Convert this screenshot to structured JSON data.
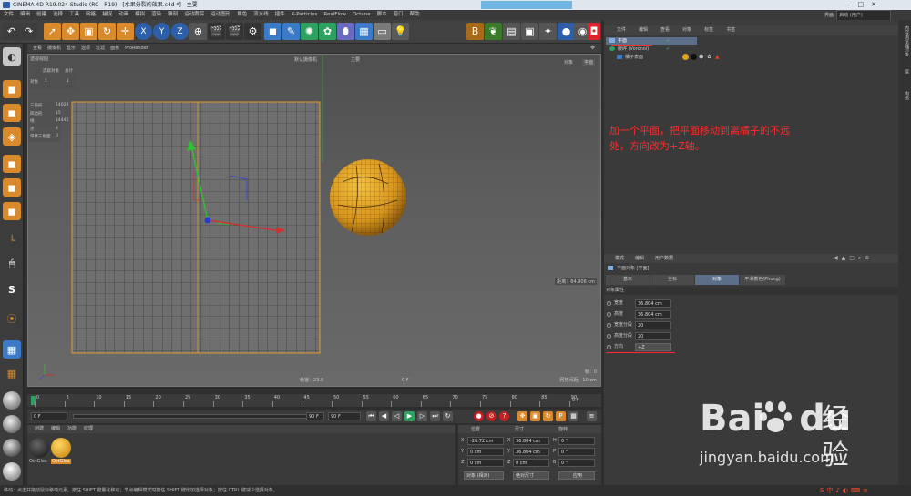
{
  "window": {
    "title": "CINEMA 4D R19.024 Studio (RC - R19) - [水果分裂的效果.c4d *] - 主要"
  },
  "menubar": [
    "文件",
    "编辑",
    "创建",
    "选择",
    "工具",
    "网格",
    "捕捉",
    "动画",
    "模拟",
    "渲染",
    "雕刻",
    "运动跟踪",
    "运动图形",
    "角色",
    "流水线",
    "插件",
    "X-Particles",
    "RealFlow",
    "Octane",
    "脚本",
    "窗口",
    "帮助"
  ],
  "interface": {
    "label": "界面:",
    "value": "启动 (用户)"
  },
  "toolbar": {
    "axis_x": "X",
    "axis_y": "Y",
    "axis_z": "Z"
  },
  "viewport": {
    "menu": [
      "查看",
      "摄像机",
      "显示",
      "选项",
      "过滤",
      "面板",
      "ProRender"
    ],
    "name": "透视视图",
    "camera_label": "默认摄像机",
    "camera_icon_label": "主要",
    "top_right_1": "对象",
    "top_right_2": "平面",
    "stats_header": [
      "选取对象",
      "总计"
    ],
    "stats_object_row": [
      "对象",
      "1",
      "1"
    ],
    "stats": [
      {
        "k": "三角形",
        "v": "14024"
      },
      {
        "k": "四边形",
        "v": "15"
      },
      {
        "k": "线",
        "v": "14445"
      },
      {
        "k": "点",
        "v": "4"
      },
      {
        "k": "带状三角面",
        "v": "0"
      }
    ],
    "distance": "距离：84.906 cm",
    "frame_rate": "帧速：23.8",
    "frame_center": "0 F",
    "grid_spacing": "网格间距：10 cm",
    "bottom_right_counter": "帧：0"
  },
  "timeline": {
    "ticks": [
      "0",
      "5",
      "10",
      "15",
      "20",
      "25",
      "30",
      "35",
      "40",
      "45",
      "50",
      "55",
      "60",
      "65",
      "70",
      "75",
      "80",
      "85",
      "90"
    ],
    "end": "0 F"
  },
  "transport": {
    "start": "0 F",
    "range_end": "90 F",
    "end": "90 F"
  },
  "materials": {
    "menu": [
      "创建",
      "编辑",
      "功能",
      "纹理"
    ],
    "items": [
      {
        "name": "OctGlos",
        "color": "#1d1d1d"
      },
      {
        "name": "OctGlos",
        "color": "#e0a020"
      }
    ]
  },
  "coords": {
    "headers": [
      "位置",
      "尺寸",
      "旋转"
    ],
    "rows": [
      {
        "axis": "X",
        "pos": "-26.72 cm",
        "size": "36.804 cm",
        "rot_label": "H",
        "rot": "0 °"
      },
      {
        "axis": "Y",
        "pos": "0 cm",
        "size": "36.804 cm",
        "rot_label": "P",
        "rot": "0 °"
      },
      {
        "axis": "Z",
        "pos": "0 cm",
        "size": "0 cm",
        "rot_label": "B",
        "rot": "0 °"
      }
    ],
    "mode": "对象 (相对)",
    "size_mode": "绝对尺寸",
    "apply": "应用"
  },
  "object_manager": {
    "menu": [
      "文件",
      "编辑",
      "查看",
      "对象",
      "标签",
      "书签"
    ],
    "objects": [
      {
        "name": "平面",
        "selected": true
      },
      {
        "name": "破碎 (Voronoi)",
        "selected": false
      },
      {
        "name": "橘子表面",
        "selected": false
      }
    ]
  },
  "annotation": "加一个平面，把平面移动到离橘子的不远处，方向改为+Z轴。",
  "attributes": {
    "menu": [
      "模式",
      "编辑",
      "用户数据"
    ],
    "title": "平面对象 [平面]",
    "tabs": [
      "基本",
      "坐标",
      "对象",
      "平滑着色(Phong)"
    ],
    "active_tab": "对象",
    "section": "对象属性",
    "fields": [
      {
        "label": "宽度",
        "value": "36.804 cm"
      },
      {
        "label": "高度",
        "value": "36.804 cm"
      },
      {
        "label": "宽度分段",
        "value": "20"
      },
      {
        "label": "高度分段",
        "value": "20"
      }
    ],
    "direction_label": "方向",
    "direction_value": "+Z"
  },
  "side_tabs": [
    "内容浏览器",
    "对象",
    "层",
    "构造"
  ],
  "status": "移动：点击并拖动鼠标移动元素。按住 SHIFT 键量化移动；节点编辑模式时按住 SHIFT 键增加选择对象；按住 CTRL 键减少选择对象。",
  "watermark": {
    "brand": "Bai",
    "brand2": "du",
    "suffix": "经验",
    "url": "jingyan.baidu.com"
  },
  "colors": {
    "accent": "#5b6e8a",
    "highlight_red": "#ff2a2a",
    "plane_edge": "#e09a30",
    "orange": "#e0a020"
  }
}
